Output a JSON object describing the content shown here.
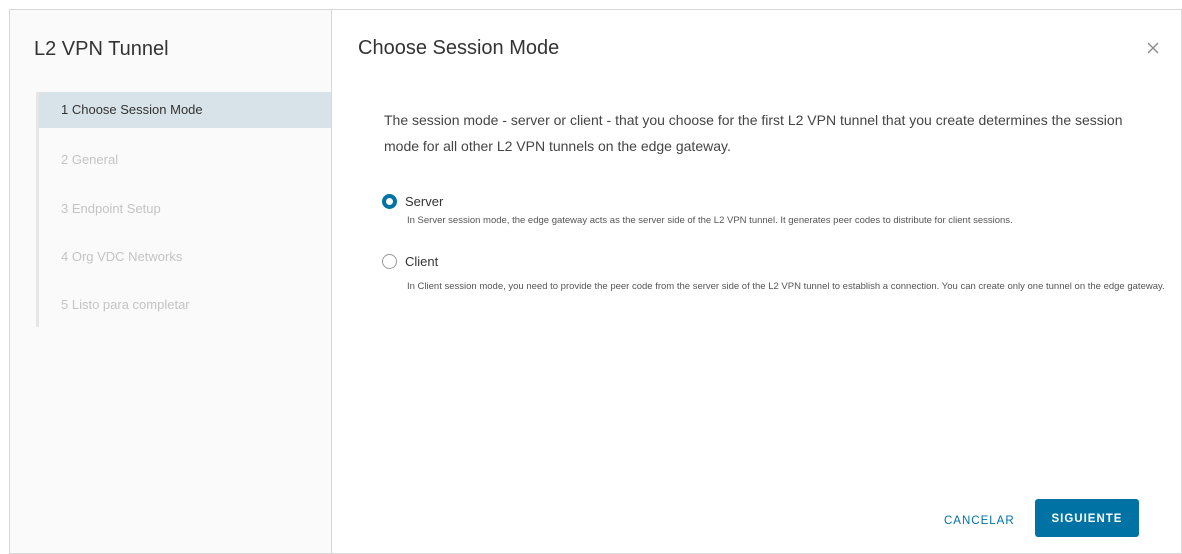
{
  "sidebar": {
    "title": "L2 VPN Tunnel",
    "steps": [
      {
        "label": "1  Choose Session Mode",
        "active": true
      },
      {
        "label": "2  General",
        "active": false
      },
      {
        "label": "3  Endpoint Setup",
        "active": false
      },
      {
        "label": "4  Org VDC Networks",
        "active": false
      },
      {
        "label": "5  Listo para completar",
        "active": false
      }
    ]
  },
  "main": {
    "title": "Choose Session Mode",
    "close_icon": "close-icon",
    "description": "The session mode - server or client - that you choose for the first L2 VPN tunnel that you create determines the session mode for all other L2 VPN tunnels on the edge gateway.",
    "options": [
      {
        "label": "Server",
        "checked": true,
        "help": "In Server session mode, the edge gateway acts as the server side of the L2 VPN tunnel. It generates peer codes to distribute for client sessions."
      },
      {
        "label": "Client",
        "checked": false,
        "help": "In Client session mode, you need to provide the peer code from the server side of the L2 VPN tunnel to establish a connection. You can create only one tunnel on the edge gateway."
      }
    ]
  },
  "footer": {
    "cancel_label": "CANCELAR",
    "next_label": "SIGUIENTE"
  },
  "colors": {
    "accent": "#0072a3",
    "active_step_bg": "#d8e3e9",
    "inactive_step_text": "#c4c4c4"
  }
}
